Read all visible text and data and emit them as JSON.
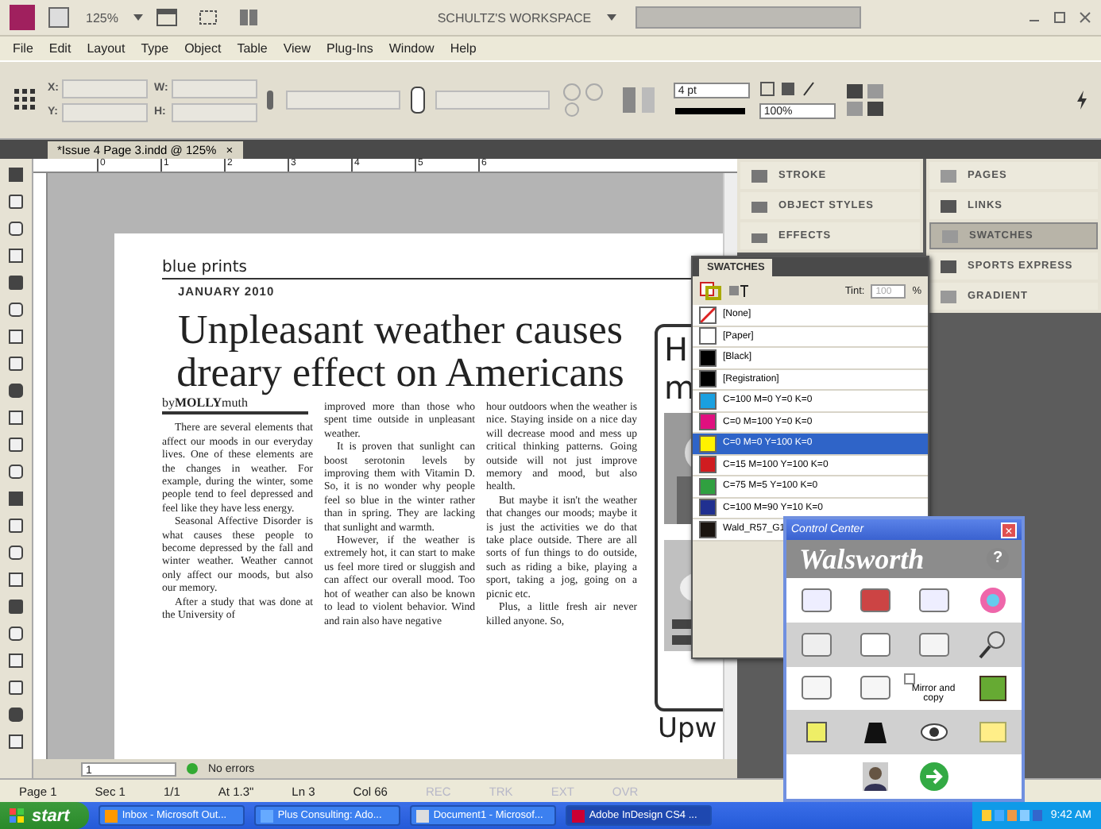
{
  "app_bar": {
    "zoom": "125%",
    "workspace": "SCHULTZ'S WORKSPACE"
  },
  "menu": [
    "File",
    "Edit",
    "Layout",
    "Type",
    "Object",
    "Table",
    "View",
    "Plug-Ins",
    "Window",
    "Help"
  ],
  "control_panel": {
    "x_label": "X:",
    "y_label": "Y:",
    "w_label": "W:",
    "h_label": "H:",
    "stroke_weight": "4 pt",
    "opacity": "100%"
  },
  "document_tab": {
    "title": "*Issue 4 Page 3.indd @ 125%",
    "close": "×"
  },
  "ruler_marks": [
    "0",
    "1",
    "2",
    "3",
    "4",
    "5",
    "6"
  ],
  "article": {
    "section": "blue prints",
    "date": "JANUARY 2010",
    "headline": "Unpleasant weather causes dreary effect on Americans",
    "byline": "by**MOLLY**muth",
    "columns": [
      [
        "There are several elements that affect our moods in our everyday lives. One of these elements are the changes in weather. For example, during the winter, some people tend to feel depressed and feel like they have less energy.",
        "Seasonal Affective Disorder is what causes these people to become depressed by the fall and winter weather. Weather cannot only affect our moods, but also our memory.",
        "After a study that was done at the University of"
      ],
      [
        "improved more than those who spent time outside in unpleasant weather.",
        "It is proven that sunlight can boost serotonin levels by improving them with Vitamin D. So, it is no wonder why people feel so blue in the winter rather than in spring. They are lacking that sunlight and warmth.",
        "However, if the weather is extremely hot, it can start to make us feel more tired or sluggish and can affect our overall mood. Too hot of weather can also be known to lead to violent behavior. Wind and rain also have negative"
      ],
      [
        "hour outdoors when the weather is nice. Staying inside on a nice day will decrease mood and mess up critical thinking patterns. Going outside will not just improve memory and mood, but also health.",
        "But maybe it isn't the weather that changes our moods; maybe it is just the activities we do that take place outside. There are all sorts of fun things to do outside, such as riding a bike, playing a sport, taking a jog, going on a picnic etc.",
        "Plus, a little fresh air never killed anyone. So,"
      ]
    ]
  },
  "sidebar_box": {
    "headline_top": "H",
    "headline_second": "m",
    "headline_bottom": "Upw"
  },
  "doc_footer": {
    "page": "1",
    "preflight": "No errors"
  },
  "dock_left": [
    {
      "label": "STROKE"
    },
    {
      "label": "OBJECT STYLES"
    },
    {
      "label": "EFFECTS"
    }
  ],
  "dock_right": [
    {
      "label": "PAGES",
      "selected": false
    },
    {
      "label": "LINKS",
      "selected": false
    },
    {
      "label": "SWATCHES",
      "selected": true
    },
    {
      "label": "SPORTS EXPRESS",
      "selected": false
    },
    {
      "label": "GRADIENT",
      "selected": false
    }
  ],
  "swatches_panel": {
    "title": "SWATCHES",
    "tint_label": "Tint:",
    "tint": "100",
    "percent": "%",
    "swatches": [
      {
        "name": "[None]",
        "kind": "none",
        "color": "#ffffff",
        "selected": false
      },
      {
        "name": "[Paper]",
        "kind": "solid",
        "color": "#ffffff",
        "selected": false
      },
      {
        "name": "[Black]",
        "kind": "solid",
        "color": "#000000",
        "selected": false
      },
      {
        "name": "[Registration]",
        "kind": "solid",
        "color": "#000000",
        "selected": false
      },
      {
        "name": "C=100 M=0 Y=0 K=0",
        "kind": "solid",
        "color": "#1aa0e0",
        "selected": false
      },
      {
        "name": "C=0 M=100 Y=0 K=0",
        "kind": "solid",
        "color": "#e0107f",
        "selected": false
      },
      {
        "name": "C=0 M=0 Y=100 K=0",
        "kind": "solid",
        "color": "#fff200",
        "selected": true
      },
      {
        "name": "C=15 M=100 Y=100 K=0",
        "kind": "solid",
        "color": "#d01c20",
        "selected": false
      },
      {
        "name": "C=75 M=5 Y=100 K=0",
        "kind": "solid",
        "color": "#30a040",
        "selected": false
      },
      {
        "name": "C=100 M=90 Y=10 K=0",
        "kind": "solid",
        "color": "#203090",
        "selected": false
      },
      {
        "name": "Wald_R57_G1",
        "kind": "solid",
        "color": "#1a1410",
        "selected": false
      }
    ]
  },
  "control_center": {
    "title": "Control Center",
    "close": "×",
    "brand": "Walsworth",
    "help": "?",
    "mirror_label": "Mirror and copy",
    "mirror_checked": false
  },
  "status_bar": [
    {
      "label": "Page 1",
      "disabled": false
    },
    {
      "label": "Sec 1",
      "disabled": false
    },
    {
      "label": "1/1",
      "disabled": false
    },
    {
      "label": "At 1.3\"",
      "disabled": false
    },
    {
      "label": "Ln 3",
      "disabled": false
    },
    {
      "label": "Col 66",
      "disabled": false
    },
    {
      "label": "REC",
      "disabled": true
    },
    {
      "label": "TRK",
      "disabled": true
    },
    {
      "label": "EXT",
      "disabled": true
    },
    {
      "label": "OVR",
      "disabled": true
    }
  ],
  "taskbar": {
    "start": "start",
    "tasks": [
      {
        "label": "Inbox - Microsoft Out...",
        "selected": false
      },
      {
        "label": "Plus Consulting: Ado...",
        "selected": false
      },
      {
        "label": "Document1 - Microsof...",
        "selected": false
      },
      {
        "label": "Adobe InDesign CS4 ...",
        "selected": true
      }
    ],
    "clock": "9:42 AM"
  }
}
